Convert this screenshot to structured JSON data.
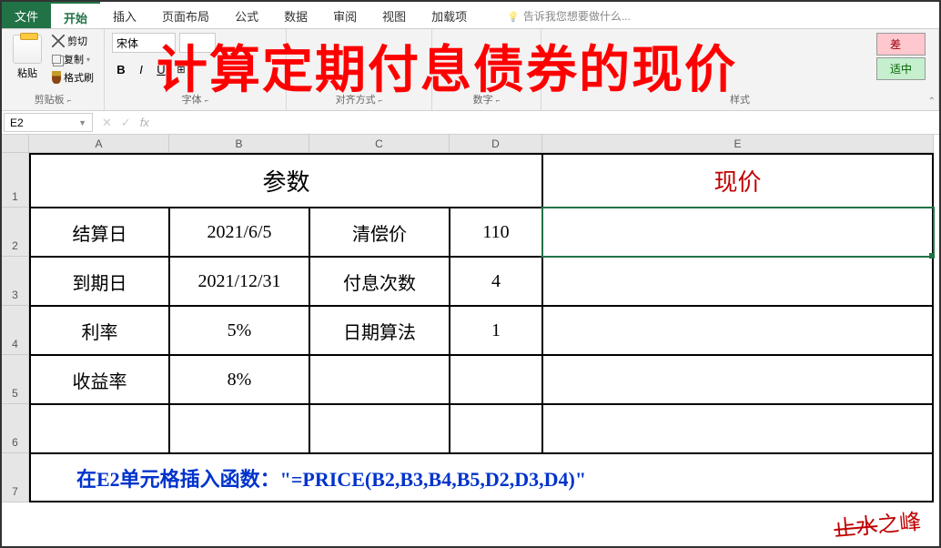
{
  "menu": {
    "file": "文件",
    "home": "开始",
    "insert": "插入",
    "layout": "页面布局",
    "formulas": "公式",
    "data": "数据",
    "review": "审阅",
    "view": "视图",
    "addins": "加载项",
    "tellme": "告诉我您想要做什么..."
  },
  "ribbon": {
    "paste": "粘贴",
    "cut": "剪切",
    "copy": "复制",
    "format_painter": "格式刷",
    "clipboard_label": "剪贴板",
    "font_name": "宋体",
    "font_size": "",
    "font_label": "字体",
    "align_label": "对齐方式",
    "number_label": "数字",
    "styles_label": "样式",
    "badge_bad": "差",
    "badge_good": "适中"
  },
  "namebox": "E2",
  "formula": "",
  "columns": [
    "A",
    "B",
    "C",
    "D",
    "E"
  ],
  "rows": [
    "1",
    "2",
    "3",
    "4",
    "5",
    "6",
    "7"
  ],
  "table": {
    "header_params": "参数",
    "header_price": "现价",
    "r2": {
      "a": "结算日",
      "b": "2021/6/5",
      "c": "清偿价",
      "d": "110"
    },
    "r3": {
      "a": "到期日",
      "b": "2021/12/31",
      "c": "付息次数",
      "d": "4"
    },
    "r4": {
      "a": "利率",
      "b": "5%",
      "c": "日期算法",
      "d": "1"
    },
    "r5": {
      "a": "收益率",
      "b": "8%",
      "c": "",
      "d": ""
    }
  },
  "overlay_title": "计算定期付息债券的现价",
  "formula_note": "在E2单元格插入函数：\"=PRICE(B2,B3,B4,B5,D2,D3,D4)\"",
  "signature": "止水之峰"
}
